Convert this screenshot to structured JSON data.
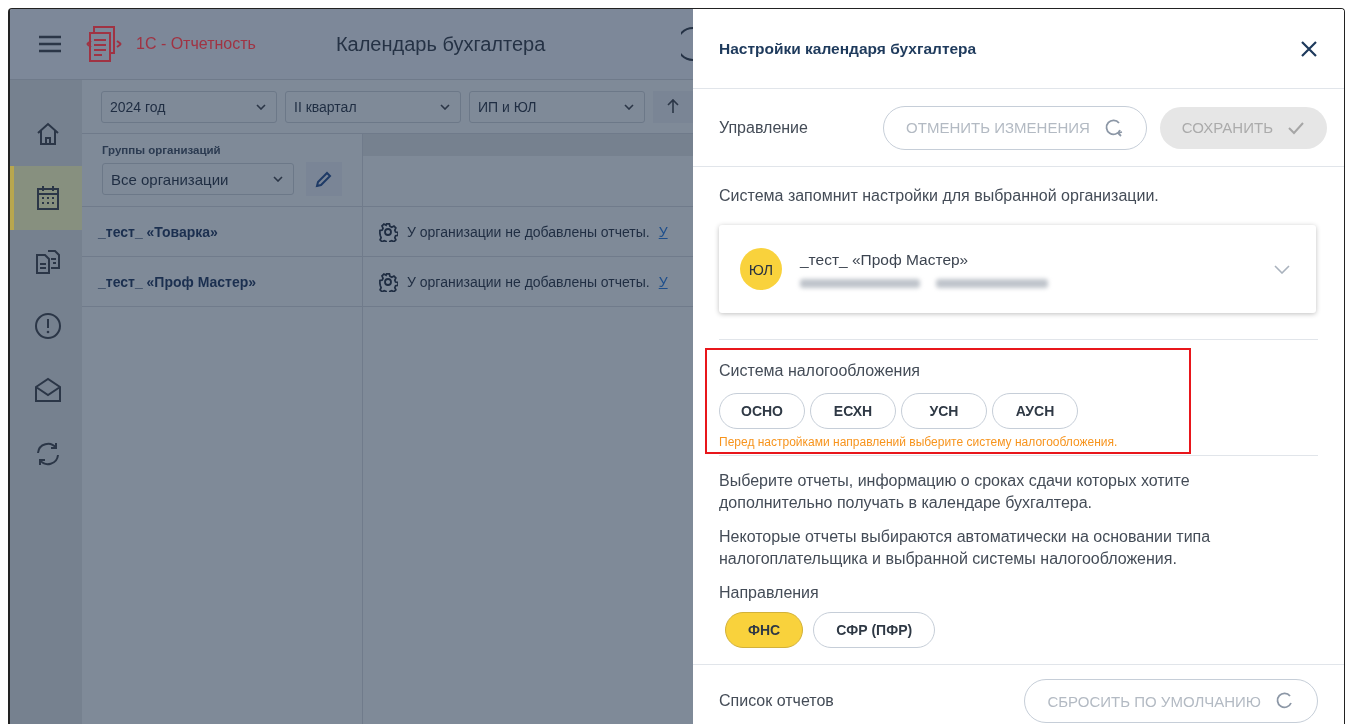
{
  "app": {
    "logo_text": "1С - Отчетность",
    "title": "Календарь бухгалтера",
    "nav": [
      {
        "kind": "home",
        "selected": false
      },
      {
        "kind": "calendar",
        "selected": true
      },
      {
        "kind": "documents",
        "selected": false
      },
      {
        "kind": "alert",
        "selected": false
      },
      {
        "kind": "mail",
        "selected": false
      },
      {
        "kind": "sync",
        "selected": false
      }
    ],
    "filters": [
      {
        "value": "2024 год"
      },
      {
        "value": "II квартал"
      },
      {
        "value": "ИП и ЮЛ"
      }
    ],
    "group_label": "Группы организаций",
    "group_value": "Все организации",
    "organizations": [
      {
        "name": "_тест_ «Товарка»",
        "status": "У организации не добавлены отчеты.",
        "link": "У"
      },
      {
        "name": "_тест_ «Проф Мастер»",
        "status": "У организации не добавлены отчеты.",
        "link": "У"
      }
    ]
  },
  "panel": {
    "title": "Настройки календаря бухгалтера",
    "management_label": "Управление",
    "cancel_button": {
      "label": "ОТМЕНИТЬ ИЗМЕНЕНИЯ",
      "disabled": true
    },
    "save_button": {
      "label": "СОХРАНИТЬ",
      "disabled": true
    },
    "notice": "Система запомнит настройки для выбранной организации.",
    "organization": {
      "badge": "ЮЛ",
      "name": "_тест_ «Проф Мастер»"
    },
    "tax_system": {
      "label": "Система налогообложения",
      "highlighted": true,
      "options": [
        {
          "label": "ОСНО",
          "selected": false
        },
        {
          "label": "ЕСХН",
          "selected": false
        },
        {
          "label": "УСН",
          "selected": false
        },
        {
          "label": "АУСН",
          "selected": false
        }
      ],
      "warning": "Перед настройками направлений выберите систему налогообложения."
    },
    "descriptions": [
      "Выберите отчеты, информацию о сроках сдачи которых хотите дополнительно получать в календаре бухгалтера.",
      "Некоторые отчеты выбираются автоматически на основании типа налогоплательщика и выбранной системы налогообложения."
    ],
    "directions": {
      "label": "Направления",
      "options": [
        {
          "label": "ФНС",
          "selected": true
        },
        {
          "label": "СФР (ПФР)",
          "selected": false
        }
      ]
    },
    "reports_label": "Список отчетов",
    "reset_button": "СБРОСИТЬ ПО УМОЛЧАНИЮ"
  }
}
